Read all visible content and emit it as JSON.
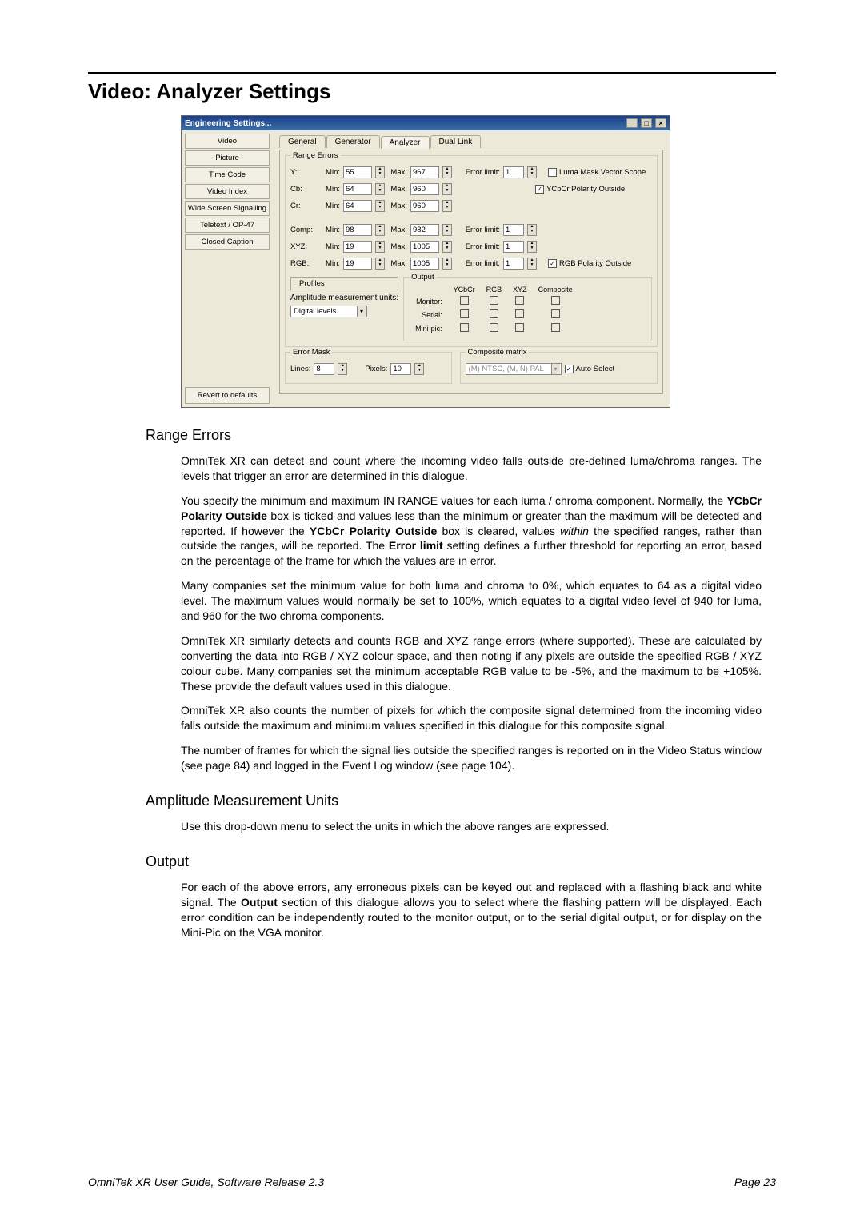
{
  "page_heading": "Video: Analyzer Settings",
  "window": {
    "title": "Engineering Settings...",
    "sidebar": [
      "Video",
      "Picture",
      "Time Code",
      "Video Index",
      "Wide Screen Signalling",
      "Teletext / OP-47",
      "Closed Caption"
    ],
    "revert": "Revert to defaults",
    "tabs": [
      "General",
      "Generator",
      "Analyzer",
      "Dual Link"
    ],
    "active_tab": 2,
    "range_errors": {
      "legend": "Range Errors",
      "rows": [
        {
          "name": "Y:",
          "min": "55",
          "max": "967",
          "err": "1"
        },
        {
          "name": "Cb:",
          "min": "64",
          "max": "960"
        },
        {
          "name": "Cr:",
          "min": "64",
          "max": "960"
        },
        {
          "name": "Comp:",
          "min": "98",
          "max": "982",
          "err": "1"
        },
        {
          "name": "XYZ:",
          "min": "19",
          "max": "1005",
          "err": "1"
        },
        {
          "name": "RGB:",
          "min": "19",
          "max": "1005",
          "err": "1"
        }
      ],
      "min_label": "Min:",
      "max_label": "Max:",
      "err_label": "Error limit:",
      "chk_luma": "Luma Mask Vector Scope",
      "chk_ycbcr": "YCbCr Polarity Outside",
      "chk_rgb": "RGB Polarity Outside",
      "profiles_btn": "Profiles",
      "amu_label": "Amplitude measurement units:",
      "amu_value": "Digital levels",
      "output_legend": "Output",
      "output_cols": [
        "YCbCr",
        "RGB",
        "XYZ",
        "Composite"
      ],
      "output_rows": [
        "Monitor:",
        "Serial:",
        "Mini-pic:"
      ]
    },
    "error_mask": {
      "legend": "Error Mask",
      "lines_label": "Lines:",
      "lines": "8",
      "pixels_label": "Pixels:",
      "pixels": "10"
    },
    "composite": {
      "legend": "Composite matrix",
      "value": "(M) NTSC, (M, N) PAL",
      "auto": "Auto Select"
    }
  },
  "sections": {
    "range_title": "Range Errors",
    "range_p1": "OmniTek XR can detect and count where the incoming video falls outside pre-defined luma/chroma ranges. The levels that trigger an error are determined in this dialogue.",
    "range_p2a": "You specify the minimum and maximum IN RANGE values for each luma / chroma component. Normally, the ",
    "range_p2b": "YCbCr Polarity Outside",
    "range_p2c": " box is ticked and values less than the minimum or greater than the maximum will be detected and reported. If however the ",
    "range_p2d": "YCbCr Polarity Outside",
    "range_p2e": " box is cleared, values ",
    "range_p2f": "within",
    "range_p2g": " the specified ranges, rather than outside the ranges, will be reported. The ",
    "range_p2h": "Error limit",
    "range_p2i": " setting defines a further threshold for reporting an error, based on the percentage of the frame for which the values are in error.",
    "range_p3": "Many companies set the minimum value for both luma and chroma to 0%, which equates to 64 as a digital video level. The maximum values would normally be set to 100%, which equates to a digital video level of 940 for luma, and 960 for the two chroma components.",
    "range_p4": "OmniTek XR similarly detects and counts RGB and XYZ range errors (where supported). These are calculated by converting the data into RGB / XYZ colour space, and then noting if any pixels are outside the specified RGB / XYZ colour cube. Many companies set the minimum acceptable RGB value to be -5%, and the maximum to be +105%. These provide the default values used in this dialogue.",
    "range_p5": "OmniTek XR also counts the number of pixels for which the composite signal determined from the incoming video falls outside the maximum and minimum values specified in this dialogue for this composite signal.",
    "range_p6": "The number of frames for which the signal lies outside the specified ranges is reported on in the Video Status window (see page 84) and logged in the Event Log window (see page 104).",
    "amu_title": "Amplitude Measurement Units",
    "amu_p": "Use this drop-down menu to select the units in which the above ranges are expressed.",
    "out_title": "Output",
    "out_p_a": "For each of the above errors, any erroneous pixels can be keyed out and replaced with a flashing black and white signal. The ",
    "out_p_b": "Output",
    "out_p_c": " section of this dialogue allows you to select where the flashing pattern will be displayed. Each error condition can be independently routed to the monitor output, or to the serial digital output, or for display on the Mini-Pic on the VGA monitor."
  },
  "footer": {
    "left": "OmniTek XR User Guide, Software Release 2.3",
    "right": "Page 23"
  }
}
